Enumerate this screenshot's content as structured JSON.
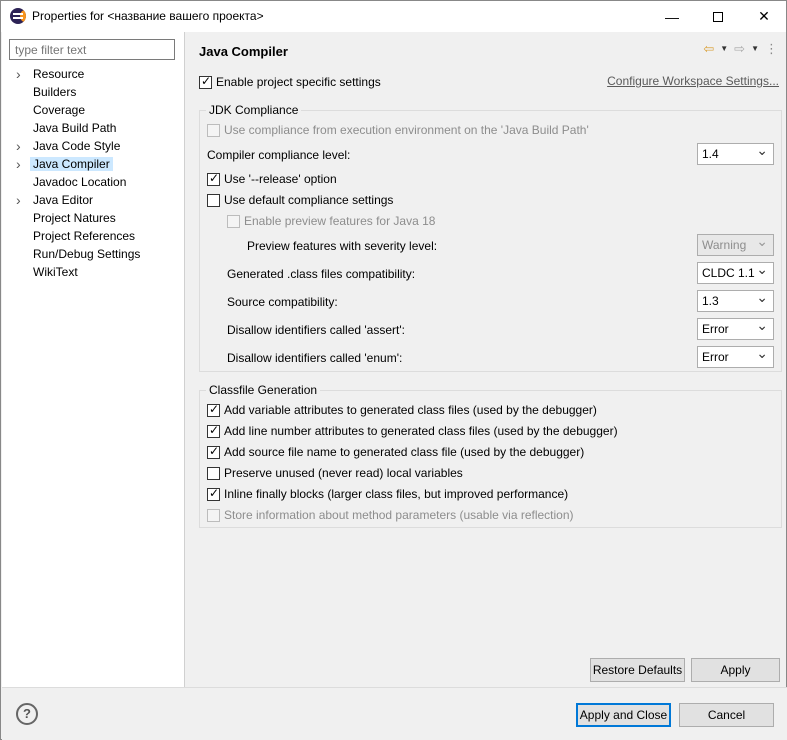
{
  "window": {
    "title": "Properties for <название вашего проекта>",
    "minimize_glyph": "—",
    "close_glyph": "✕"
  },
  "filter": {
    "placeholder": "type filter text"
  },
  "tree": [
    {
      "label": "Resource",
      "expandable": true
    },
    {
      "label": "Builders",
      "expandable": false
    },
    {
      "label": "Coverage",
      "expandable": false
    },
    {
      "label": "Java Build Path",
      "expandable": false
    },
    {
      "label": "Java Code Style",
      "expandable": true
    },
    {
      "label": "Java Compiler",
      "expandable": true,
      "selected": true
    },
    {
      "label": "Javadoc Location",
      "expandable": false
    },
    {
      "label": "Java Editor",
      "expandable": true
    },
    {
      "label": "Project Natures",
      "expandable": false
    },
    {
      "label": "Project References",
      "expandable": false
    },
    {
      "label": "Run/Debug Settings",
      "expandable": false
    },
    {
      "label": "WikiText",
      "expandable": false
    }
  ],
  "page": {
    "title": "Java Compiler",
    "nav": {
      "back": "⇦",
      "forward": "⇨",
      "dropdown": "▼",
      "menu": "⋮"
    },
    "enable_specific": {
      "label": "Enable project specific settings",
      "checked": true
    },
    "configure_link": "Configure Workspace Settings...",
    "jdk": {
      "title": "JDK Compliance",
      "use_compliance": {
        "label": "Use compliance from execution environment on the 'Java Build Path'",
        "checked": false,
        "disabled": true
      },
      "compliance_level": {
        "label": "Compiler compliance level:",
        "value": "1.4"
      },
      "use_release": {
        "label": "Use '--release' option",
        "checked": true
      },
      "use_default": {
        "label": "Use default compliance settings",
        "checked": false
      },
      "enable_preview": {
        "label": "Enable preview features for Java 18",
        "checked": false,
        "disabled": true
      },
      "preview_severity": {
        "label": "Preview features with severity level:",
        "value": "Warning",
        "disabled": true
      },
      "class_compat": {
        "label": "Generated .class files compatibility:",
        "value": "CLDC 1.1"
      },
      "source_compat": {
        "label": "Source compatibility:",
        "value": "1.3"
      },
      "assert": {
        "label": "Disallow identifiers called 'assert':",
        "value": "Error"
      },
      "enum": {
        "label": "Disallow identifiers called 'enum':",
        "value": "Error"
      }
    },
    "classfile": {
      "title": "Classfile Generation",
      "items": [
        {
          "label": "Add variable attributes to generated class files (used by the debugger)",
          "checked": true,
          "disabled": false
        },
        {
          "label": "Add line number attributes to generated class files (used by the debugger)",
          "checked": true,
          "disabled": false
        },
        {
          "label": "Add source file name to generated class file (used by the debugger)",
          "checked": true,
          "disabled": false
        },
        {
          "label": "Preserve unused (never read) local variables",
          "checked": false,
          "disabled": false
        },
        {
          "label": "Inline finally blocks (larger class files, but improved performance)",
          "checked": true,
          "disabled": false
        },
        {
          "label": "Store information about method parameters (usable via reflection)",
          "checked": false,
          "disabled": true
        }
      ]
    },
    "restore_defaults": "Restore Defaults",
    "apply": "Apply"
  },
  "bottom": {
    "help": "?",
    "apply_close": "Apply and Close",
    "cancel": "Cancel"
  }
}
